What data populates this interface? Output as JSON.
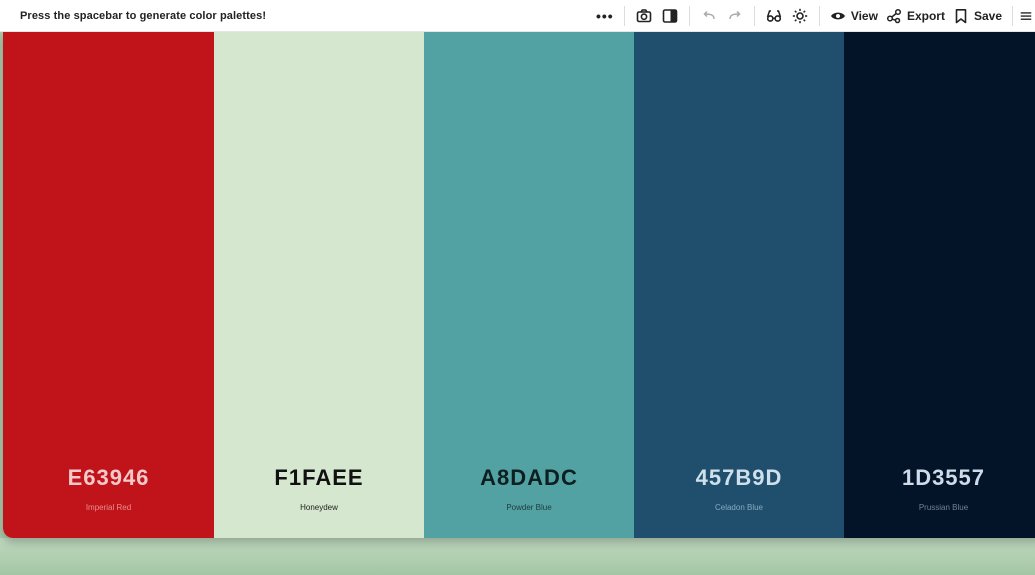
{
  "toolbar": {
    "hint": "Press the spacebar to generate color palettes!",
    "more_label": "•••",
    "view_label": "View",
    "export_label": "Export",
    "save_label": "Save"
  },
  "palette": [
    {
      "hex": "E63946",
      "name": "Imperial Red",
      "color": "#c0141a",
      "text_color": "#f4c9c9",
      "name_color": "#e88e8e"
    },
    {
      "hex": "F1FAEE",
      "name": "Honeydew",
      "color": "#d5e8cf",
      "text_color": "#111111",
      "name_color": "#222222"
    },
    {
      "hex": "A8DADC",
      "name": "Powder Blue",
      "color": "#53a2a3",
      "text_color": "#0d1f20",
      "name_color": "#1c3b3c"
    },
    {
      "hex": "457B9D",
      "name": "Celadon Blue",
      "color": "#1f4f6d",
      "text_color": "#cfe0ec",
      "name_color": "#8aa9bf"
    },
    {
      "hex": "1D3557",
      "name": "Prussian Blue",
      "color": "#041428",
      "text_color": "#cfdbe9",
      "name_color": "#6f8199"
    }
  ]
}
